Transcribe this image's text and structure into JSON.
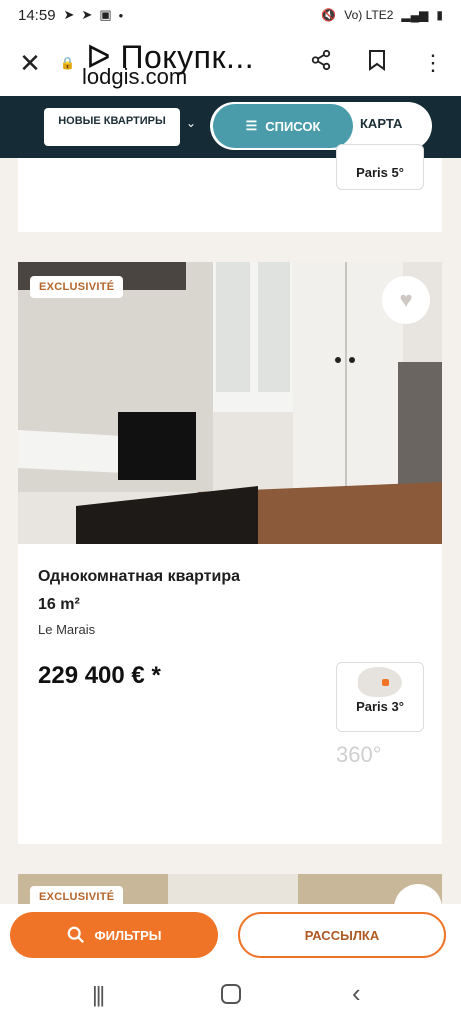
{
  "status": {
    "time": "14:59",
    "network": "Vo) LTE2",
    "icons": [
      "telegram-icon",
      "telegram-icon",
      "image-icon",
      "dot-icon"
    ]
  },
  "browser": {
    "title": "ᐅ Покупк...",
    "url": "lodgis.com",
    "close": "✕",
    "lock": "🔒",
    "share": "share-icon",
    "bookmark": "bookmark-icon",
    "menu": "⋮"
  },
  "nav": {
    "new_label": "НОВЫЕ КВАРТИРЫ",
    "list_label": "СПИСОК",
    "map_label": "КАРТА"
  },
  "prev_listing": {
    "district": "Paris 5°"
  },
  "listing": {
    "badge": "EXCLUSIVITÉ",
    "title": "Однокомнатная квартира",
    "area": "16 m²",
    "neighborhood": "Le Marais",
    "price": "229 400 € *",
    "district": "Paris 3°",
    "tour": "360°"
  },
  "next_listing": {
    "badge": "EXCLUSIVITÉ"
  },
  "actions": {
    "filters": "ФИЛЬТРЫ",
    "newsletter": "РАССЫЛКА"
  },
  "colors": {
    "accent": "#f07427",
    "navbar": "#152c36",
    "toggle_active": "#4b9cab"
  }
}
